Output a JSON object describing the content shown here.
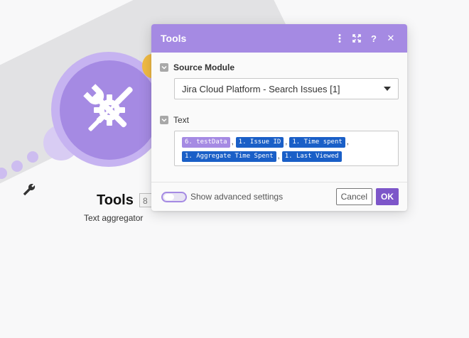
{
  "module": {
    "title": "Tools",
    "id": "8",
    "subtitle": "Text aggregator"
  },
  "dialog": {
    "title": "Tools",
    "header_icons": [
      "more-vertical-icon",
      "expand-icon",
      "help-icon",
      "close-icon"
    ],
    "help_glyph": "?",
    "close_glyph": "✕",
    "source_module": {
      "label": "Source Module",
      "value": "Jira Cloud Platform - Search Issues [1]"
    },
    "text_field": {
      "label": "Text",
      "tokens": [
        {
          "text": "6. testData",
          "color": "#a58ae3"
        },
        {
          "text": "1. Issue ID",
          "color": "#1a5fc7"
        },
        {
          "text": "1. Time spent",
          "color": "#1a5fc7"
        },
        {
          "text": "1. Aggregate Time Spent",
          "color": "#1a5fc7"
        },
        {
          "text": "1. Last Viewed",
          "color": "#1a5fc7"
        }
      ],
      "separator": ","
    },
    "footer": {
      "advanced_label": "Show advanced settings",
      "cancel_label": "Cancel",
      "ok_label": "OK"
    }
  },
  "colors": {
    "accent": "#a58ae3",
    "ok_button": "#7d56c9",
    "token_blue": "#1a5fc7",
    "badge": "#f1bb44"
  }
}
